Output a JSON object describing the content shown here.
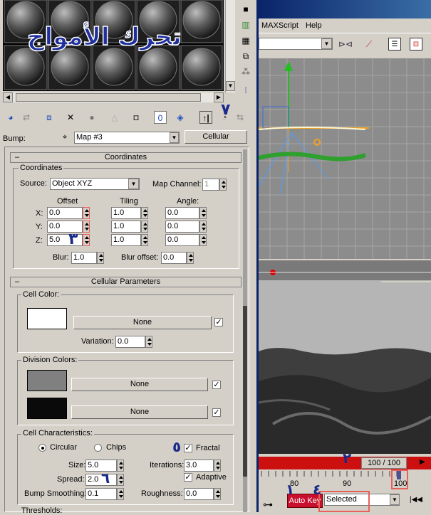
{
  "overlay": {
    "title": "تحرك الأمواج",
    "n1": "١",
    "n2": "٢",
    "n3": "٣",
    "n4": "٤",
    "n5": "٥",
    "n6": "٦",
    "n7": "٧"
  },
  "menubar": {
    "maxscript": "MAXScript",
    "help": "Help"
  },
  "bump": {
    "label": "Bump:",
    "map": "Map #3",
    "type": "Cellular"
  },
  "coords": {
    "rollout": "Coordinates",
    "group": "Coordinates",
    "source_label": "Source:",
    "source_value": "Object XYZ",
    "channel_label": "Map Channel:",
    "channel_value": "1",
    "offset": "Offset",
    "tiling": "Tiling",
    "angle": "Angle:",
    "x": "X:",
    "y": "Y:",
    "z": "Z:",
    "ox": "0.0",
    "oy": "0.0",
    "oz": "5.0",
    "tx": "1.0",
    "ty": "1.0",
    "tz": "1.0",
    "ax": "0.0",
    "ay": "0.0",
    "az": "0.0",
    "blur_label": "Blur:",
    "blur": "1.0",
    "blur_offset_label": "Blur offset:",
    "blur_offset": "0.0"
  },
  "cellular": {
    "rollout": "Cellular Parameters",
    "cell_color": "Cell Color:",
    "none": "None",
    "variation_label": "Variation:",
    "variation": "0.0",
    "division": "Division Colors:",
    "characteristics": "Cell Characteristics:",
    "circular": "Circular",
    "chips": "Chips",
    "fractal": "Fractal",
    "size_label": "Size:",
    "size": "5.0",
    "spread_label": "Spread:",
    "spread": "2.0",
    "bump_smooth_label": "Bump Smoothing:",
    "bump_smooth": "0.1",
    "iterations_label": "Iterations:",
    "iterations": "3.0",
    "adaptive": "Adaptive",
    "roughness_label": "Roughness:",
    "roughness": "0.0",
    "thresholds": "Thresholds:"
  },
  "timeline": {
    "frame": "100 / 100",
    "t80": "80",
    "t90": "90",
    "t100": "100",
    "autokey": "Auto Key",
    "selected": "Selected"
  },
  "colors": {
    "cell": "#ffffff",
    "div1": "#808080",
    "div2": "#0a0a0a",
    "autokey": "#c8102e"
  }
}
